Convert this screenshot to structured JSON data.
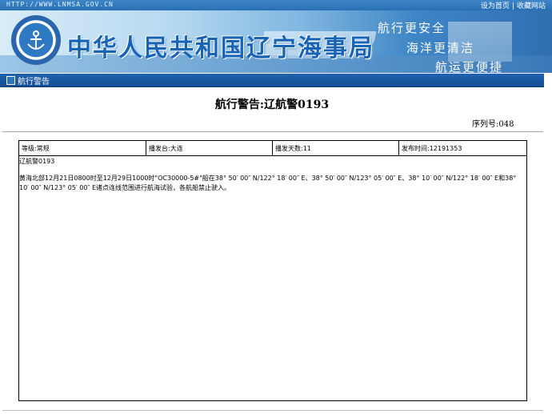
{
  "header": {
    "url": "HTTP://WWW.LNMSA.GOV.CN",
    "links": [
      "设为首页",
      "收藏网站"
    ],
    "separator": "|",
    "site_title": "中华人民共和国辽宁海事局",
    "slogans": [
      "航行更安全",
      "海洋更清洁",
      "航运更便捷"
    ]
  },
  "section": {
    "label": "航行警告"
  },
  "notice": {
    "title": "航行警告:辽航警0193",
    "serial": "序列号:048",
    "fields": [
      {
        "label": "等级:常规"
      },
      {
        "label": "播发台:大连"
      },
      {
        "label": "播发天数:11"
      },
      {
        "label": "发布时间:12191353"
      }
    ],
    "code": "辽航警0193",
    "content": "黄海北部12月21日0800时至12月29日1000时\"OC30000-5#\"船在38° 50′ 00″ N/122° 18′ 00″ E、38° 50′ 00″ N/123° 05′ 00″ E、38° 10′ 00″ N/122° 18′ 00″ E和38° 10′ 00″ N/123° 05′ 00″ E诸点连线范围进行航海试验，各航船禁止驶入。"
  },
  "colors": {
    "accent": "#1f63b0",
    "title": "#1763b5"
  }
}
